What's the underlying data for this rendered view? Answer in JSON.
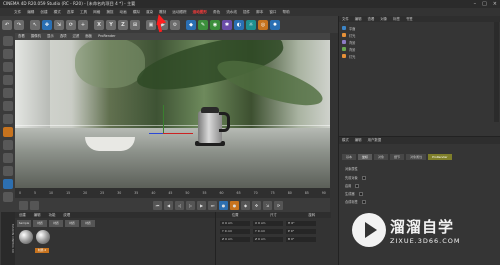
{
  "window": {
    "title": "CINEMA 4D R20.059 Studio (RC - R20) - [未命名的项目 4 *] - 主要"
  },
  "menubar": {
    "items": [
      "文件",
      "编辑",
      "创建",
      "模式",
      "选择",
      "工具",
      "网格",
      "捕捉",
      "动画",
      "模拟",
      "渲染",
      "雕刻",
      "运动跟踪",
      "运动图形",
      "角色",
      "流水线",
      "插件",
      "脚本",
      "窗口",
      "帮助"
    ],
    "highlight": "运动图形"
  },
  "viewport": {
    "menu": [
      "查看",
      "摄像机",
      "显示",
      "选项",
      "过滤",
      "面板",
      "ProRender"
    ]
  },
  "timeline": {
    "ticks": [
      "0",
      "5",
      "10",
      "15",
      "20",
      "25",
      "30",
      "35",
      "40",
      "45",
      "50",
      "55",
      "60",
      "65",
      "70",
      "75",
      "80",
      "85",
      "90"
    ]
  },
  "material": {
    "tabs": [
      "创建",
      "编辑",
      "功能",
      "纹理"
    ],
    "toolbar": [
      "Sample",
      "材质",
      "材质",
      "材质",
      "材质"
    ],
    "label": "材质.2"
  },
  "coordinates": {
    "headers": [
      "位置",
      "尺寸",
      "旋转"
    ],
    "rows": [
      [
        "X 0 cm",
        "X 0 cm",
        "H 0°"
      ],
      [
        "Y 0 cm",
        "Y 0 cm",
        "P 0°"
      ],
      [
        "Z 0 cm",
        "Z 0 cm",
        "B 0°"
      ]
    ]
  },
  "objects": {
    "tabs": [
      "文件",
      "编辑",
      "查看",
      "对象",
      "标签",
      "书签"
    ],
    "items": [
      "平面",
      "灯光",
      "背景",
      "背景",
      "灯光"
    ]
  },
  "attributes": {
    "tabs": [
      "模式",
      "编辑",
      "用户数据"
    ],
    "subtabs": [
      "基本",
      "坐标",
      "对象",
      "细节",
      "对象属性",
      "ProRender"
    ],
    "section": "对象属性",
    "rows": [
      "先前对象",
      "启用",
      "生成器",
      "合成标签"
    ]
  },
  "watermark": {
    "big": "溜溜自学",
    "small": "ZIXUE.3D66.COM"
  },
  "sidebar": {
    "logo": "MAXON CINEMA 4D"
  }
}
